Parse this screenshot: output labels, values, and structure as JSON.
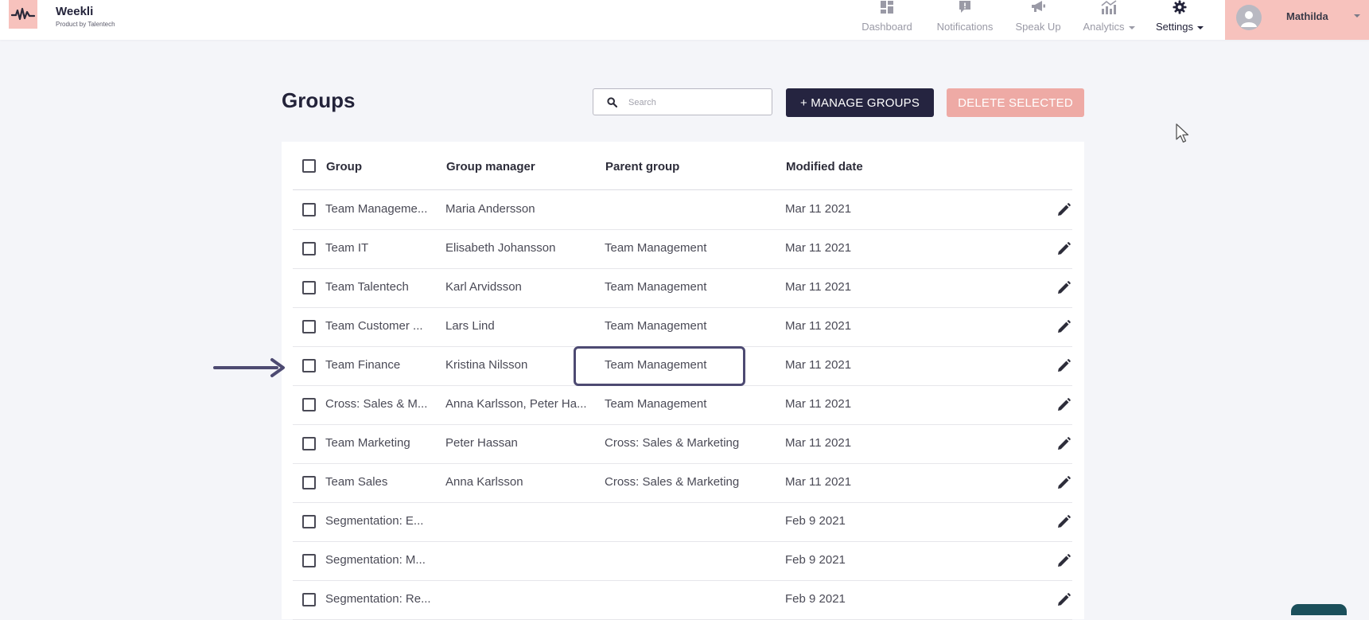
{
  "brand": {
    "name": "Weekli",
    "tagline": "Product by Talentech",
    "accent": "#f7c2bd"
  },
  "nav": [
    {
      "label": "Dashboard",
      "icon": "dashboard-icon",
      "has_dropdown": false,
      "active": false
    },
    {
      "label": "Notifications",
      "icon": "notification-icon",
      "has_dropdown": false,
      "active": false
    },
    {
      "label": "Speak Up",
      "icon": "megaphone-icon",
      "has_dropdown": false,
      "active": false
    },
    {
      "label": "Analytics",
      "icon": "analytics-icon",
      "has_dropdown": true,
      "active": false
    },
    {
      "label": "Settings",
      "icon": "gear-icon",
      "has_dropdown": true,
      "active": true
    }
  ],
  "user": {
    "name": "Mathilda"
  },
  "page": {
    "title": "Groups"
  },
  "search": {
    "placeholder": "Search",
    "value": ""
  },
  "actions": {
    "manage_label": "+ MANAGE GROUPS",
    "delete_label": "DELETE SELECTED"
  },
  "table": {
    "columns": [
      "Group",
      "Group manager",
      "Parent group",
      "Modified date"
    ],
    "rows": [
      {
        "group": "Team Manageme...",
        "manager": "Maria Andersson",
        "parent": "",
        "modified": "Mar 11 2021",
        "checked": false
      },
      {
        "group": "Team IT",
        "manager": "Elisabeth Johansson",
        "parent": "Team Management",
        "modified": "Mar 11 2021",
        "checked": false
      },
      {
        "group": "Team Talentech",
        "manager": "Karl Arvidsson",
        "parent": "Team Management",
        "modified": "Mar 11 2021",
        "checked": false
      },
      {
        "group": "Team Customer ...",
        "manager": "Lars Lind",
        "parent": "Team Management",
        "modified": "Mar 11 2021",
        "checked": false
      },
      {
        "group": "Team Finance",
        "manager": "Kristina Nilsson",
        "parent": "Team Management",
        "modified": "Mar 11 2021",
        "checked": false
      },
      {
        "group": "Cross: Sales & M...",
        "manager": "Anna Karlsson, Peter Ha...",
        "parent": "Team Management",
        "modified": "Mar 11 2021",
        "checked": false
      },
      {
        "group": "Team Marketing",
        "manager": "Peter Hassan",
        "parent": "Cross: Sales & Marketing",
        "modified": "Mar 11 2021",
        "checked": false
      },
      {
        "group": "Team Sales",
        "manager": "Anna Karlsson",
        "parent": "Cross: Sales & Marketing",
        "modified": "Mar 11 2021",
        "checked": false
      },
      {
        "group": "Segmentation: E...",
        "manager": "",
        "parent": "",
        "modified": "Feb 9 2021",
        "checked": false
      },
      {
        "group": "Segmentation: M...",
        "manager": "",
        "parent": "",
        "modified": "Feb 9 2021",
        "checked": false
      },
      {
        "group": "Segmentation: Re...",
        "manager": "",
        "parent": "",
        "modified": "Feb 9 2021",
        "checked": false
      }
    ]
  },
  "annotation": {
    "color": "#4d4a72"
  }
}
